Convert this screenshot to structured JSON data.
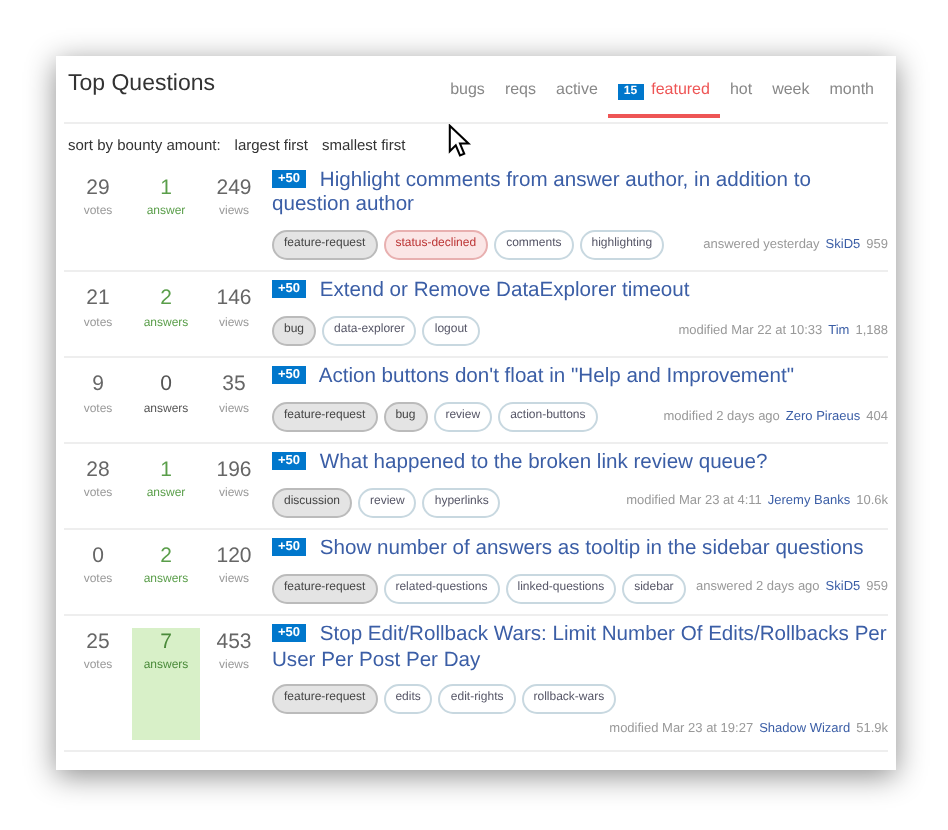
{
  "header": {
    "title": "Top Questions"
  },
  "tabs": [
    {
      "label": "bugs",
      "selected": false
    },
    {
      "label": "reqs",
      "selected": false
    },
    {
      "label": "active",
      "selected": false
    },
    {
      "label": "featured",
      "badge": "15",
      "selected": true
    },
    {
      "label": "hot",
      "selected": false
    },
    {
      "label": "week",
      "selected": false
    },
    {
      "label": "month",
      "selected": false
    }
  ],
  "sort": {
    "label": "sort by bounty amount:",
    "options": [
      {
        "label": "largest first"
      },
      {
        "label": "smallest first"
      }
    ]
  },
  "questions": [
    {
      "votes": "29",
      "votes_label": "votes",
      "answers": "1",
      "answers_label": "answer",
      "answered": true,
      "accepted": false,
      "views": "249",
      "views_label": "views",
      "bounty": "+50",
      "title": "Highlight comments from answer author, in addition to question author",
      "tags": [
        {
          "label": "feature-request",
          "kind": "required"
        },
        {
          "label": "status-declined",
          "kind": "declined"
        },
        {
          "label": "comments",
          "kind": "normal"
        },
        {
          "label": "highlighting",
          "kind": "normal"
        }
      ],
      "activity": "answered yesterday",
      "user": "SkiD5",
      "rep": "959"
    },
    {
      "votes": "21",
      "votes_label": "votes",
      "answers": "2",
      "answers_label": "answers",
      "answered": true,
      "accepted": false,
      "views": "146",
      "views_label": "views",
      "bounty": "+50",
      "title": "Extend or Remove DataExplorer timeout",
      "tags": [
        {
          "label": "bug",
          "kind": "required"
        },
        {
          "label": "data-explorer",
          "kind": "normal"
        },
        {
          "label": "logout",
          "kind": "normal"
        }
      ],
      "activity": "modified Mar 22 at 10:33",
      "user": "Tim",
      "rep": "1,188"
    },
    {
      "votes": "9",
      "votes_label": "votes",
      "answers": "0",
      "answers_label": "answers",
      "answered": false,
      "accepted": false,
      "views": "35",
      "views_label": "views",
      "bounty": "+50",
      "title": "Action buttons don't float in \"Help and Improvement\"",
      "tags": [
        {
          "label": "feature-request",
          "kind": "required"
        },
        {
          "label": "bug",
          "kind": "required"
        },
        {
          "label": "review",
          "kind": "normal"
        },
        {
          "label": "action-buttons",
          "kind": "normal"
        }
      ],
      "activity": "modified 2 days ago",
      "user": "Zero Piraeus",
      "rep": "404"
    },
    {
      "votes": "28",
      "votes_label": "votes",
      "answers": "1",
      "answers_label": "answer",
      "answered": true,
      "accepted": false,
      "views": "196",
      "views_label": "views",
      "bounty": "+50",
      "title": "What happened to the broken link review queue?",
      "tags": [
        {
          "label": "discussion",
          "kind": "required"
        },
        {
          "label": "review",
          "kind": "normal"
        },
        {
          "label": "hyperlinks",
          "kind": "normal"
        }
      ],
      "activity": "modified Mar 23 at 4:11",
      "user": "Jeremy Banks",
      "rep": "10.6k"
    },
    {
      "votes": "0",
      "votes_label": "votes",
      "answers": "2",
      "answers_label": "answers",
      "answered": true,
      "accepted": false,
      "views": "120",
      "views_label": "views",
      "bounty": "+50",
      "title": "Show number of answers as tooltip in the sidebar questions",
      "tags": [
        {
          "label": "feature-request",
          "kind": "required"
        },
        {
          "label": "related-questions",
          "kind": "normal"
        },
        {
          "label": "linked-questions",
          "kind": "normal"
        },
        {
          "label": "sidebar",
          "kind": "normal"
        }
      ],
      "activity": "answered 2 days ago",
      "user": "SkiD5",
      "rep": "959"
    },
    {
      "votes": "25",
      "votes_label": "votes",
      "answers": "7",
      "answers_label": "answers",
      "answered": true,
      "accepted": true,
      "views": "453",
      "views_label": "views",
      "bounty": "+50",
      "title": "Stop Edit/Rollback Wars: Limit Number Of Edits/Rollbacks Per User Per Post Per Day",
      "tags": [
        {
          "label": "feature-request",
          "kind": "required"
        },
        {
          "label": "edits",
          "kind": "normal"
        },
        {
          "label": "edit-rights",
          "kind": "normal"
        },
        {
          "label": "rollback-wars",
          "kind": "normal"
        }
      ],
      "activity": "modified Mar 23 at 19:27",
      "user": "Shadow Wizard",
      "rep": "51.9k"
    }
  ]
}
